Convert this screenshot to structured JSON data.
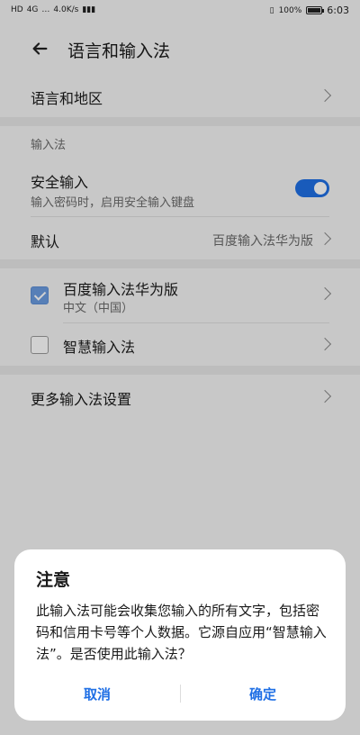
{
  "status_bar": {
    "left_texts": [
      "HD",
      "4G",
      "…",
      "4.0K/s"
    ],
    "battery_text": "100%",
    "time": "6:03",
    "battery_level": 1.0
  },
  "app_bar": {
    "title": "语言和输入法"
  },
  "list": {
    "language_region": "语言和地区",
    "section_input": "输入法",
    "secure_input": {
      "title": "安全输入",
      "subtitle": "输入密码时，启用安全输入键盘",
      "enabled": true
    },
    "default": {
      "label": "默认",
      "value": "百度输入法华为版"
    },
    "keyboards": [
      {
        "title": "百度输入法华为版",
        "subtitle": "中文（中国）",
        "checked": true
      },
      {
        "title": "智慧输入法",
        "subtitle": "",
        "checked": false
      }
    ],
    "more_settings": "更多输入法设置"
  },
  "dialog": {
    "title": "注意",
    "body": "此输入法可能会收集您输入的所有文字，包括密码和信用卡号等个人数据。它源自应用“智慧输入法”。是否使用此输入法？",
    "cancel": "取消",
    "ok": "确定"
  },
  "colors": {
    "accent": "#1f6fe5",
    "checkbox_checked": "#6b9be0",
    "screen_bg": "#f4f4f4"
  }
}
